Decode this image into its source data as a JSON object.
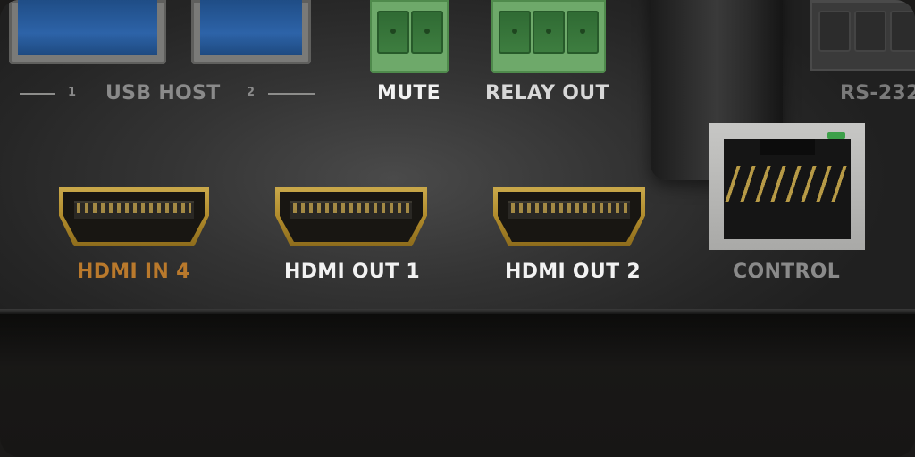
{
  "image": {
    "subject": "rear connector panel of an AV device",
    "labels": {
      "usb_num_1": "1",
      "usb_host": "USB HOST",
      "usb_num_2": "2",
      "mute": "MUTE",
      "relay_out": "RELAY OUT",
      "rs232": "RS-232",
      "hdmi_in_4": "HDMI IN 4",
      "hdmi_out_1": "HDMI OUT 1",
      "hdmi_out_2": "HDMI OUT 2",
      "control": "CONTROL"
    },
    "colors": {
      "highlight_label": "#b9792c",
      "label_white": "#f2f2f2",
      "label_muted": "#8a8a8a",
      "hdmi_gold": "#c9a84a",
      "terminal_green": "#6ea96a",
      "usb_blue": "#2d63a8"
    }
  }
}
